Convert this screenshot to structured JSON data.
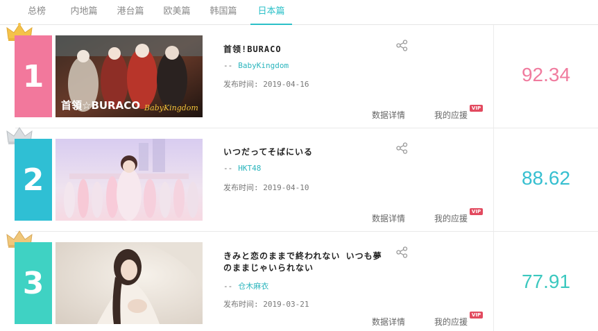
{
  "tabs": [
    {
      "label": "总榜"
    },
    {
      "label": "内地篇"
    },
    {
      "label": "港台篇"
    },
    {
      "label": "欧美篇"
    },
    {
      "label": "韩国篇"
    },
    {
      "label": "日本篇",
      "active": true
    }
  ],
  "common": {
    "dash": "--",
    "detail_label": "数据详情",
    "support_label": "我的应援",
    "vip_badge": "VIP"
  },
  "entries": [
    {
      "rank": "1",
      "title": "首领!BURACO",
      "artist": "BabyKingdom",
      "date": "发布时间: 2019-04-16",
      "score": "92.34",
      "rank_color": "#f2789c",
      "score_color": "#f07b9e",
      "crown": "gold-crown-icon",
      "cover_text_a": "首領☆BURACO",
      "cover_text_b": "BabyKingdom"
    },
    {
      "rank": "2",
      "title": "いつだってそばにいる",
      "artist": "HKT48",
      "date": "发布时间: 2019-04-10",
      "score": "88.62",
      "rank_color": "#2fbfd4",
      "score_color": "#36bfd0",
      "crown": "silver-crown-icon"
    },
    {
      "rank": "3",
      "title": "きみと恋のままで終われない いつも夢のままじゃいられない",
      "artist": "仓木麻衣",
      "date": "发布时间: 2019-03-21",
      "score": "77.91",
      "rank_color": "#3fd2c3",
      "score_color": "#3cc8bf",
      "crown": "bronze-crown-icon"
    }
  ]
}
